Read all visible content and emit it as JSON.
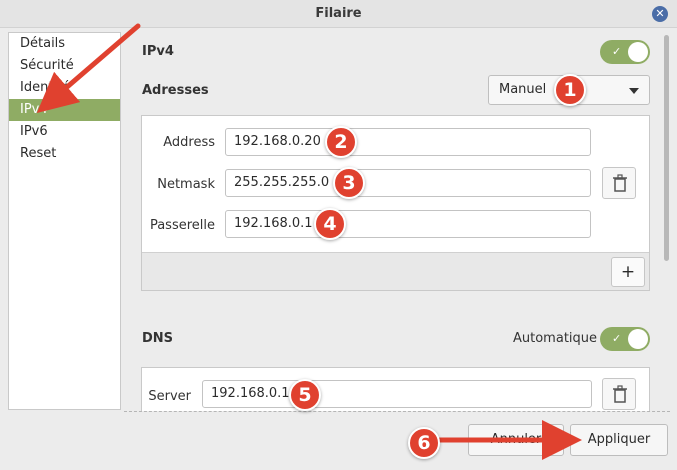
{
  "window": {
    "title": "Filaire",
    "close_icon": "close-icon"
  },
  "sidebar": {
    "items": [
      {
        "label": "Détails",
        "active": false
      },
      {
        "label": "Sécurité",
        "active": false
      },
      {
        "label": "Identité",
        "active": false
      },
      {
        "label": "IPv4",
        "active": true
      },
      {
        "label": "IPv6",
        "active": false
      },
      {
        "label": "Reset",
        "active": false
      }
    ]
  },
  "ipv4": {
    "label": "IPv4",
    "enabled": true
  },
  "addresses": {
    "label": "Adresses",
    "method": "Manuel"
  },
  "fields": {
    "address": {
      "label": "Address",
      "value": "192.168.0.20"
    },
    "netmask": {
      "label": "Netmask",
      "value": "255.255.255.0"
    },
    "gateway": {
      "label": "Passerelle",
      "value": "192.168.0.1"
    }
  },
  "add_button": {
    "label": "+"
  },
  "dns": {
    "label": "DNS",
    "auto_label": "Automatique",
    "auto_enabled": true,
    "server_label": "Server",
    "server_value": "192.168.0.1"
  },
  "buttons": {
    "cancel": "Annuler",
    "apply": "Appliquer"
  },
  "badges": [
    "1",
    "2",
    "3",
    "4",
    "5",
    "6"
  ],
  "colors": {
    "accent_green": "#8fac64",
    "badge_red": "#e0412f",
    "arrow_red": "#e0412f"
  }
}
